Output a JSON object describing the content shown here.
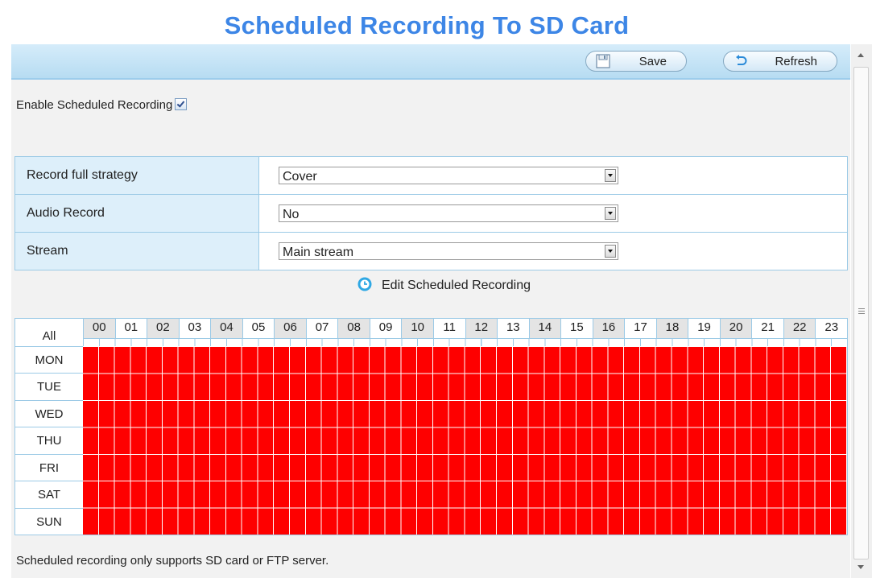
{
  "page": {
    "title": "Scheduled Recording To SD Card"
  },
  "toolbar": {
    "save_label": "Save",
    "refresh_label": "Refresh"
  },
  "enable": {
    "label": "Enable Scheduled Recording",
    "checked": true
  },
  "settings": {
    "record_full_strategy": {
      "label": "Record full strategy",
      "value": "Cover"
    },
    "audio_record": {
      "label": "Audio Record",
      "value": "No"
    },
    "stream": {
      "label": "Stream",
      "value": "Main stream"
    }
  },
  "edit_schedule_label": "Edit Scheduled Recording",
  "schedule": {
    "all_label": "All",
    "hours": [
      "00",
      "01",
      "02",
      "03",
      "04",
      "05",
      "06",
      "07",
      "08",
      "09",
      "10",
      "11",
      "12",
      "13",
      "14",
      "15",
      "16",
      "17",
      "18",
      "19",
      "20",
      "21",
      "22",
      "23"
    ],
    "days": [
      "MON",
      "TUE",
      "WED",
      "THU",
      "FRI",
      "SAT",
      "SUN"
    ],
    "all_slots_selected": true,
    "selected_color": "#fe0000"
  },
  "footer_note": "Scheduled recording only supports SD card or FTP server.",
  "colors": {
    "title": "#3d86e6",
    "toolbar": "#c6e4f6",
    "label_cell": "#ddeffa",
    "border": "#9ccae6"
  }
}
